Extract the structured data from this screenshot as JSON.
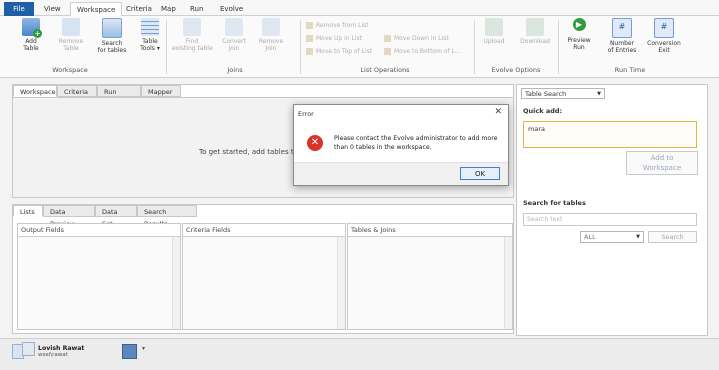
{
  "menu": {
    "file": "File",
    "tabs": [
      "View",
      "Workspace",
      "Criteria",
      "Map",
      "Run",
      "Evolve"
    ],
    "active_index": 1
  },
  "ribbon": {
    "buttons": {
      "add_table": "Add\nTable",
      "remove_table": "Remove\nTable",
      "search_tables": "Search\nfor tables",
      "table_tools": "Table\nTools",
      "find_existing": "Find\nexisting table",
      "convert_join": "Convert\nJoin",
      "remove_join": "Remove\nJoin",
      "upload": "Upload",
      "download": "Download",
      "preview_run": "Preview\nRun",
      "number_of_entries": "Number\nof Entries",
      "conversion_exit": "Conversion\nExit"
    },
    "list_ops": [
      "Remove from List",
      "Move Up in List",
      "Move to Top of List",
      "Move Down in List",
      "Move to Bottom of L..."
    ],
    "groups": {
      "workspace": "Workspace",
      "joins": "Joins",
      "list_operations": "List Operations",
      "evolve_options": "Evolve Options",
      "run_time": "Run Time"
    }
  },
  "main": {
    "tabs": [
      "Workspace",
      "Criteria",
      "Run Time",
      "Mapper"
    ],
    "active_index": 0,
    "empty_message": "To get started, add tables to this"
  },
  "lists": {
    "tabs": [
      "Lists",
      "Data Preview",
      "Data Set",
      "Search Results"
    ],
    "active_index": 0,
    "columns": [
      "Output Fields",
      "Criteria Fields",
      "Tables & Joins"
    ]
  },
  "right": {
    "mode_select": "Table Search",
    "quick_add_label": "Quick add:",
    "quick_add_value": "mara",
    "add_button": "Add to\nWorkspace",
    "search_label": "Search for tables",
    "search_placeholder": "Search text",
    "filter_value": "ALL",
    "search_button": "Search"
  },
  "status": {
    "user_name": "Lovish Rawat",
    "user_id": "wsei\\rawat"
  },
  "dialog": {
    "title": "Error",
    "message": "Please contact the Evolve administrator to add more than 0 tables in the workspace.",
    "ok_label": "OK"
  },
  "colors": {
    "file_tab": "#1f5fa6",
    "error_red": "#d9342b",
    "run_green": "#2e9c3b",
    "accent_blue": "#3c7fd6"
  }
}
